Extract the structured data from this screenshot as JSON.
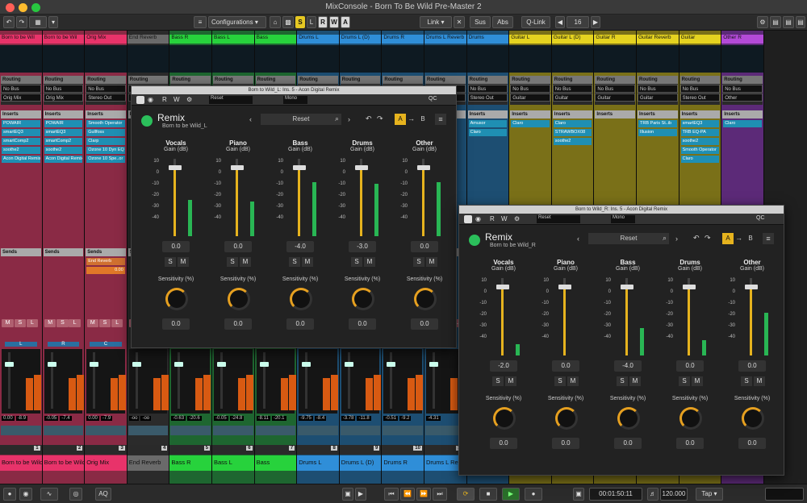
{
  "window": {
    "title": "MixConsole - Born To Be Wild Pre-Master 2"
  },
  "toolbar": {
    "configurations": "Configurations",
    "buttons": [
      "S",
      "L",
      "R",
      "W",
      "A"
    ],
    "link": "Link",
    "sus": "Sus",
    "abs": "Abs",
    "qlink": "Q-Link",
    "count": "16"
  },
  "channels": [
    {
      "name": "Born to be Wil",
      "bottom": "Born to be Wild_L",
      "num": "1",
      "color": "#e8336a",
      "body": "#8a2a45",
      "routing": [
        "No Bus",
        "Orig Mix"
      ],
      "inserts": [
        "POWAIR",
        "smartEQ3",
        "smartComp2",
        "soothe2",
        "Acon Digital Remix"
      ],
      "sends": [],
      "pan": "L",
      "vals": [
        "0.00",
        "-8.9"
      ]
    },
    {
      "name": "Born to be Wil",
      "bottom": "Born to be Wild_R",
      "num": "2",
      "color": "#e8336a",
      "body": "#8a2a45",
      "routing": [
        "No Bus",
        "Orig Mix"
      ],
      "inserts": [
        "POWAIR",
        "smartEQ3",
        "smartComp2",
        "soothe2",
        "Acon Digital Remix"
      ],
      "sends": [],
      "pan": "R",
      "vals": [
        "-0.05",
        "-7.4"
      ]
    },
    {
      "name": "Orig Mix",
      "bottom": "Orig Mix",
      "num": "3",
      "color": "#e8336a",
      "body": "#8a2a45",
      "routing": [
        "No Bus",
        "Stereo Out"
      ],
      "inserts": [
        "Smooth Operator",
        "Gullfoss",
        "Clarp",
        "Ozone 10 Dyn EQ",
        "Ozone 10 Spe..or"
      ],
      "sends": [
        "End Reverb"
      ],
      "sendval": "0.00",
      "pan": "C",
      "vals": [
        "0.00",
        "-7.9"
      ]
    },
    {
      "name": "End Reverb",
      "bottom": "End Reverb",
      "num": "4",
      "color": "#6a6a6a",
      "body": "#2b2b2b",
      "routing": [
        "",
        ""
      ],
      "inserts": [],
      "sends": [],
      "pan": "",
      "vals": [
        "-oo",
        "-oo"
      ]
    },
    {
      "name": "Bass R",
      "bottom": "Bass R",
      "num": "5",
      "color": "#27d23c",
      "body": "#1e6630",
      "routing": [
        "",
        ""
      ],
      "inserts": [],
      "sends": [],
      "pan": "",
      "vals": [
        "-0.63",
        "-20.6"
      ]
    },
    {
      "name": "Bass L",
      "bottom": "Bass L",
      "num": "6",
      "color": "#27d23c",
      "body": "#1e6630",
      "routing": [
        "",
        ""
      ],
      "inserts": [],
      "sends": [],
      "pan": "",
      "vals": [
        "-0.05",
        "-24.8"
      ]
    },
    {
      "name": "Bass",
      "bottom": "Bass",
      "num": "7",
      "color": "#27d23c",
      "body": "#1e6630",
      "routing": [
        "",
        ""
      ],
      "inserts": [],
      "sends": [],
      "pan": "",
      "vals": [
        "-8.11",
        "-20.1"
      ]
    },
    {
      "name": "Drums L",
      "bottom": "Drums L",
      "num": "8",
      "color": "#2f8ed8",
      "body": "#1d4e72",
      "routing": [
        "",
        ""
      ],
      "inserts": [],
      "sends": [],
      "pan": "",
      "vals": [
        "-9.75",
        "-8.4"
      ]
    },
    {
      "name": "Drums L (D)",
      "bottom": "Drums L (D)",
      "num": "9",
      "color": "#2f8ed8",
      "body": "#1d4e72",
      "routing": [
        "",
        ""
      ],
      "inserts": [],
      "sends": [],
      "pan": "",
      "vals": [
        "-3.78",
        "-11.8"
      ]
    },
    {
      "name": "Drums R",
      "bottom": "Drums R",
      "num": "10",
      "color": "#2f8ed8",
      "body": "#1d4e72",
      "routing": [
        "",
        ""
      ],
      "inserts": [],
      "sends": [],
      "pan": "",
      "vals": [
        "-0.51",
        "-9.2"
      ]
    },
    {
      "name": "Drums L Reverb",
      "bottom": "Drums L Re",
      "num": "11",
      "color": "#2f8ed8",
      "body": "#1d4e72",
      "routing": [
        "",
        ""
      ],
      "inserts": [],
      "sends": [],
      "pan": "",
      "vals": [
        "-4.31",
        ""
      ]
    },
    {
      "name": "Drums",
      "bottom": "",
      "num": "",
      "color": "#2f8ed8",
      "body": "#1d4e72",
      "routing": [
        "No Bus",
        "Stereo Out"
      ],
      "inserts": [
        "Amusor",
        "Claro"
      ],
      "sends": [],
      "pan": "",
      "vals": [
        "",
        ""
      ]
    },
    {
      "name": "Guitar L",
      "bottom": "",
      "num": "",
      "color": "#e5d320",
      "body": "#7a7018",
      "routing": [
        "No Bus",
        "Guitar"
      ],
      "inserts": [
        "Claro"
      ],
      "sends": [],
      "pan": "",
      "vals": [
        "",
        ""
      ]
    },
    {
      "name": "Guitar L (D)",
      "bottom": "",
      "num": "",
      "color": "#e5d320",
      "body": "#7a7018",
      "routing": [
        "No Bus",
        "Guitar"
      ],
      "inserts": [
        "Claro",
        "STRAWBOX08",
        "soothe2"
      ],
      "sends": [],
      "pan": "",
      "vals": [
        "",
        ""
      ]
    },
    {
      "name": "Guitar R",
      "bottom": "",
      "num": "",
      "color": "#e5d320",
      "body": "#7a7018",
      "routing": [
        "No Bus",
        "Guitar"
      ],
      "inserts": [],
      "sends": [],
      "pan": "",
      "vals": [
        "",
        ""
      ]
    },
    {
      "name": "Guitar Reverb",
      "bottom": "",
      "num": "",
      "color": "#e5d320",
      "body": "#7a7018",
      "routing": [
        "No Bus",
        "Guitar"
      ],
      "inserts": [
        "TRB Paris St..ib",
        "Illusion"
      ],
      "sends": [],
      "pan": "",
      "vals": [
        "",
        ""
      ]
    },
    {
      "name": "Guitar",
      "bottom": "",
      "num": "",
      "color": "#e5d320",
      "body": "#7a7018",
      "routing": [
        "No Bus",
        "Stereo Out"
      ],
      "inserts": [
        "smartEQ3",
        "TRB EQ-PA",
        "soothe2",
        "Smooth Operator",
        "Claro"
      ],
      "sends": [],
      "pan": "",
      "vals": [
        "",
        ""
      ]
    },
    {
      "name": "Other R",
      "bottom": "",
      "num": "",
      "color": "#b34ad8",
      "body": "#5c2a78",
      "routing": [
        "No Bus",
        "Other"
      ],
      "inserts": [
        "Claro"
      ],
      "sends": [],
      "pan": "",
      "vals": [
        "",
        ""
      ]
    }
  ],
  "labels": {
    "routing": "Routing",
    "inserts": "Inserts",
    "sends": "Sends",
    "m": "M",
    "s": "S",
    "l": "L",
    "e": "e"
  },
  "plugin1": {
    "title": "Born to Wild_L: Ins. 5 - Acon Digital Remix",
    "preset_field": "Reset",
    "mono": "Mono",
    "qc": "QC",
    "brand": "Remix",
    "subtitle": "Born to be Wild_L",
    "reset": "Reset",
    "a": "A",
    "b": "B",
    "columns": [
      {
        "name": "Vocals",
        "gain": "0.0",
        "sens": "0.0",
        "level": 0.47
      },
      {
        "name": "Piano",
        "gain": "0.0",
        "sens": "0.0",
        "level": 0.45
      },
      {
        "name": "Bass",
        "gain": "-4.0",
        "sens": "0.0",
        "level": 0.7
      },
      {
        "name": "Drums",
        "gain": "-3.0",
        "sens": "0.0",
        "level": 0.68
      },
      {
        "name": "Other",
        "gain": "0.0",
        "sens": "0.0",
        "level": 0.7
      }
    ],
    "gain_label": "Gain (dB)",
    "sens_label": "Sensitivity (%)",
    "scale": [
      "10",
      "0",
      "-10",
      "-20",
      "-30",
      "-40"
    ]
  },
  "plugin2": {
    "title": "Born to Wild_R: Ins. 5 - Acon Digital Remix",
    "preset_field": "Reset",
    "mono": "Mono",
    "qc": "QC",
    "brand": "Remix",
    "subtitle": "Born to be Wild_R",
    "reset": "Reset",
    "a": "A",
    "b": "B",
    "columns": [
      {
        "name": "Vocals",
        "gain": "-2.0",
        "sens": "0.0",
        "level": 0.15
      },
      {
        "name": "Piano",
        "gain": "0.0",
        "sens": "0.0",
        "level": 0.0
      },
      {
        "name": "Bass",
        "gain": "-4.0",
        "sens": "0.0",
        "level": 0.35
      },
      {
        "name": "Drums",
        "gain": "0.0",
        "sens": "0.0",
        "level": 0.2
      },
      {
        "name": "Other",
        "gain": "0.0",
        "sens": "0.0",
        "level": 0.55
      }
    ],
    "gain_label": "Gain (dB)",
    "sens_label": "Sensitivity (%)",
    "scale": [
      "10",
      "0",
      "-10",
      "-20",
      "-30",
      "-40"
    ]
  },
  "status": {
    "aq": "AQ",
    "time": "00:01:50:11",
    "tempo": "120.000",
    "tap": "Tap"
  }
}
